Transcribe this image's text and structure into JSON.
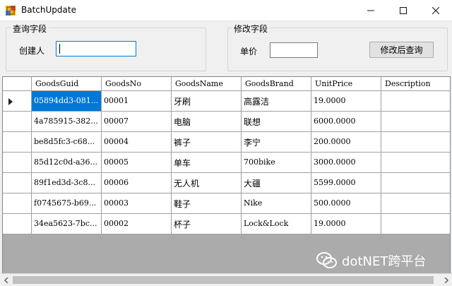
{
  "window": {
    "title": "BatchUpdate",
    "minimize_icon": "minimize-icon",
    "maximize_icon": "maximize-icon",
    "close_icon": "close-icon"
  },
  "query_group": {
    "caption": "查询字段",
    "creator_label": "创建人",
    "creator_value": ""
  },
  "modify_group": {
    "caption": "修改字段",
    "price_label": "单价",
    "price_value": "",
    "submit_label": "修改后查询"
  },
  "grid": {
    "columns": [
      "GoodsGuid",
      "GoodsNo",
      "GoodsName",
      "GoodsBrand",
      "UnitPrice",
      "Description"
    ],
    "rows": [
      [
        "05894dd3-081...",
        "00001",
        "牙刷",
        "高露洁",
        "19.0000",
        ""
      ],
      [
        "4a785915-382...",
        "00007",
        "电脑",
        "联想",
        "6000.0000",
        ""
      ],
      [
        "be8d5fc3-c68...",
        "00004",
        "裤子",
        "李宁",
        "200.0000",
        ""
      ],
      [
        "85d12c0d-a36...",
        "00005",
        "单车",
        "700bike",
        "3000.0000",
        ""
      ],
      [
        "89f1ed3d-3c8...",
        "00006",
        "无人机",
        "大疆",
        "5599.0000",
        ""
      ],
      [
        "f0745675-b69...",
        "00003",
        "鞋子",
        "Nike",
        "500.0000",
        ""
      ],
      [
        "34ea5623-7bc...",
        "00002",
        "杯子",
        "Lock&Lock",
        "19.0000",
        ""
      ]
    ],
    "current_row_indicator": "row-pointer-icon"
  },
  "watermark": {
    "text": "dotNET跨平台",
    "icon": "wechat-icon"
  },
  "colors": {
    "selection": "#0078d7",
    "grid_background": "#ababab"
  }
}
